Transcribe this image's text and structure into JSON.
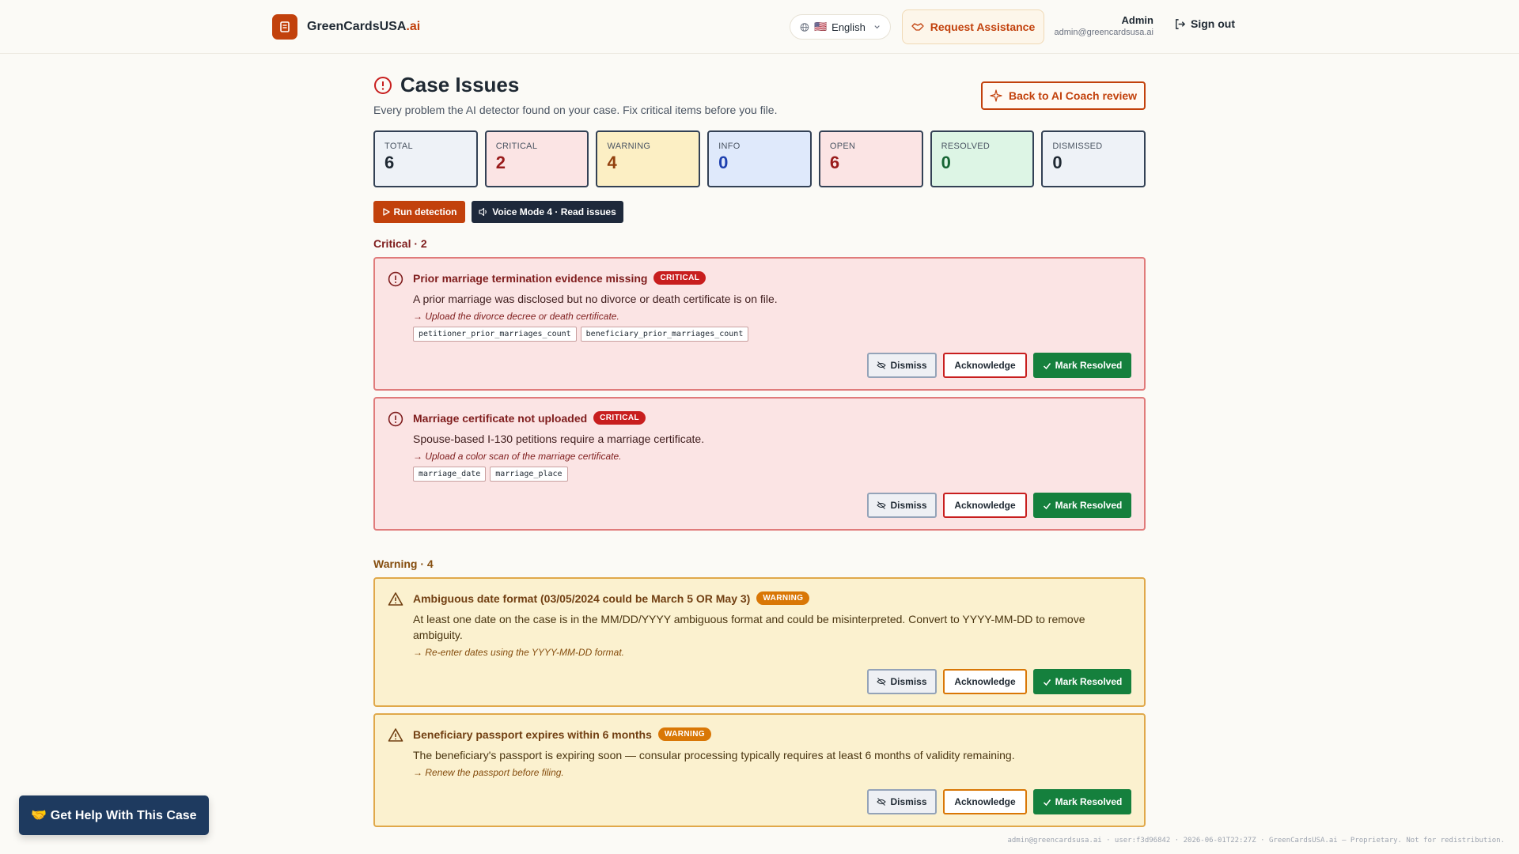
{
  "header": {
    "brand_name": "GreenCardsUSA",
    "brand_suffix": ".ai",
    "language": "English",
    "language_flag": "🇺🇸",
    "assist_label": "Request Assistance",
    "user_name": "Admin",
    "user_email": "admin@greencardsusa.ai",
    "signout_label": "Sign out"
  },
  "page": {
    "title": "Case Issues",
    "subtitle": "Every problem the AI detector found on your case. Fix critical items before you file.",
    "coach_button": "Back to AI Coach review"
  },
  "stats": [
    {
      "label": "TOTAL",
      "value": "6",
      "bg": "#eef2f7",
      "color": "#1f2933"
    },
    {
      "label": "CRITICAL",
      "value": "2",
      "bg": "#fbe4e4",
      "color": "#991b1b"
    },
    {
      "label": "WARNING",
      "value": "4",
      "bg": "#fcefc4",
      "color": "#92400e"
    },
    {
      "label": "INFO",
      "value": "0",
      "bg": "#dfe9fb",
      "color": "#1e40af"
    },
    {
      "label": "OPEN",
      "value": "6",
      "bg": "#fbe4e4",
      "color": "#991b1b"
    },
    {
      "label": "RESOLVED",
      "value": "0",
      "bg": "#ddf5e5",
      "color": "#166534"
    },
    {
      "label": "DISMISSED",
      "value": "0",
      "bg": "#eef2f7",
      "color": "#1f2933"
    }
  ],
  "actions": {
    "run_label": "Run detection",
    "voice_label": "Voice Mode 4 · Read issues"
  },
  "sections": {
    "critical_title": "Critical · 2",
    "warning_title": "Warning · 4"
  },
  "issues": [
    {
      "title": "Prior marriage termination evidence missing",
      "badge": "CRITICAL",
      "desc": "A prior marriage was disclosed but no divorce or death certificate is on file.",
      "hint": "→ Upload the divorce decree or death certificate.",
      "fields": [
        "petitioner_prior_marriages_count",
        "beneficiary_prior_marriages_count"
      ]
    },
    {
      "title": "Marriage certificate not uploaded",
      "badge": "CRITICAL",
      "desc": "Spouse-based I-130 petitions require a marriage certificate.",
      "hint": "→ Upload a color scan of the marriage certificate.",
      "fields": [
        "marriage_date",
        "marriage_place"
      ]
    },
    {
      "title": "Ambiguous date format (03/05/2024 could be March 5 OR May 3)",
      "badge": "WARNING",
      "desc": "At least one date on the case is in the MM/DD/YYYY ambiguous format and could be misinterpreted. Convert to YYYY-MM-DD to remove ambiguity.",
      "hint": "→ Re-enter dates using the YYYY-MM-DD format."
    },
    {
      "title": "Beneficiary passport expires within 6 months",
      "badge": "WARNING",
      "desc": "The beneficiary's passport is expiring soon — consular processing typically requires at least 6 months of validity remaining.",
      "hint": "→ Renew the passport before filing."
    }
  ],
  "card_actions": {
    "dismiss": "Dismiss",
    "acknowledge": "Acknowledge",
    "resolve": "Mark Resolved"
  },
  "help_button": "🤝 Get Help With This Case",
  "footer_note": "admin@greencardsusa.ai · user:f3d96842 · 2026-06-01T22:27Z · GreenCardsUSA.ai — Proprietary. Not for redistribution."
}
